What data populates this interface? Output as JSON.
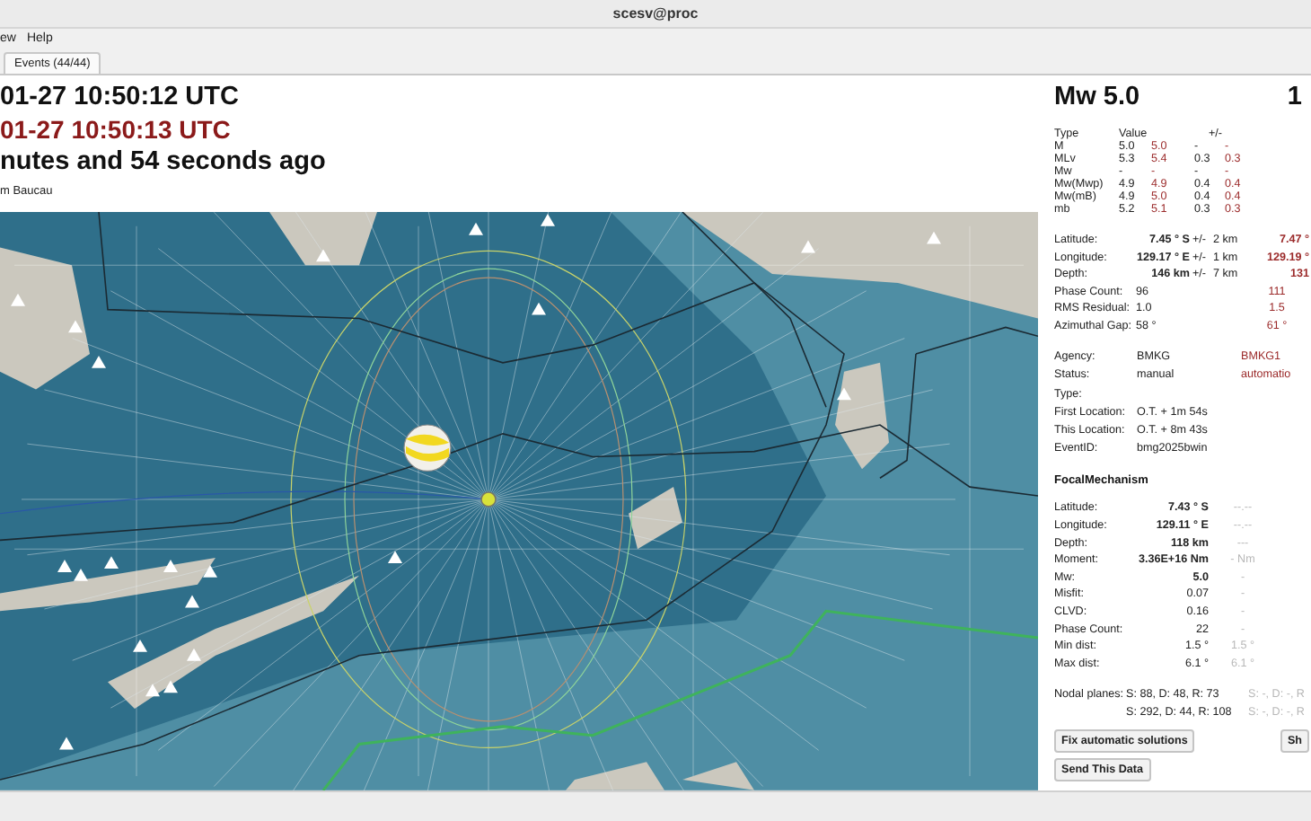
{
  "window": {
    "title": "scesv@proc"
  },
  "menu": [
    "ew",
    "Help"
  ],
  "tabs": [
    {
      "label": "Events (44/44)",
      "selected": true
    }
  ],
  "origin": {
    "time": "01-27 10:50:12 UTC",
    "time_alt": "01-27 10:50:13 UTC",
    "ago": "nutes and 54 seconds ago",
    "region": "m Baucau"
  },
  "summary": {
    "magnitude": "Mw 5.0",
    "column_2": "1"
  },
  "magnitudes": {
    "columns": [
      "Type",
      "Value",
      "+/-"
    ],
    "rows": [
      [
        "M",
        "5.0",
        "5.0",
        "-",
        "-"
      ],
      [
        "MLv",
        "5.3",
        "5.4",
        "0.3",
        "0.3"
      ],
      [
        "Mw",
        "-",
        "-",
        "-",
        "-"
      ],
      [
        "Mw(Mwp)",
        "4.9",
        "4.9",
        "0.4",
        "0.4"
      ],
      [
        "Mw(mB)",
        "4.9",
        "5.0",
        "0.4",
        "0.4"
      ],
      [
        "mb",
        "5.2",
        "5.1",
        "0.3",
        "0.3"
      ]
    ]
  },
  "location": [
    {
      "label": "Latitude:",
      "value": "7.45 ° S",
      "pm": "+/-",
      "error": "2 km",
      "alt": "7.47 °",
      "bold": true
    },
    {
      "label": "Longitude:",
      "value": "129.17 ° E",
      "pm": "+/-",
      "error": "1 km",
      "alt": "129.19 °",
      "bold": true
    },
    {
      "label": "Depth:",
      "value": "146 km",
      "pm": "+/-",
      "error": "7 km",
      "alt": "131",
      "bold": true
    },
    {
      "label": "Phase Count:",
      "value": "96",
      "alt": "111",
      "bold": false
    },
    {
      "label": "RMS Residual:",
      "value": "1.0",
      "alt": "1.5",
      "bold": false
    },
    {
      "label": "Azimuthal Gap:",
      "value": "58 °",
      "alt": "61 °",
      "bold": false
    }
  ],
  "info": [
    {
      "label": "Agency:",
      "value": "BMKG",
      "alt": "BMKG1"
    },
    {
      "label": "Status:",
      "value": "manual",
      "alt": "automatio"
    },
    {
      "label": "Type:"
    },
    {
      "label": "First Location:",
      "value": "O.T. + 1m 54s"
    },
    {
      "label": "This Location:",
      "value": "O.T. + 8m 43s"
    },
    {
      "label": "EventID:",
      "value": "bmg2025bwin"
    }
  ],
  "focal_mechanism": {
    "title": "FocalMechanism",
    "rows": [
      {
        "label": "Latitude:",
        "value": "7.43 ° S",
        "alt": "--.--",
        "bold": true
      },
      {
        "label": "Longitude:",
        "value": "129.11 ° E",
        "alt": "--.--",
        "bold": true
      },
      {
        "label": "Depth:",
        "value": "118 km",
        "alt": "---",
        "bold": true
      },
      {
        "label": "Moment:",
        "value": "3.36E+16 Nm",
        "alt": "- Nm",
        "bold": true
      },
      {
        "label": "Mw:",
        "value": "5.0",
        "alt": "-",
        "bold": true
      },
      {
        "label": "Misfit:",
        "value": "0.07",
        "alt": "-",
        "bold": false
      },
      {
        "label": "CLVD:",
        "value": "0.16",
        "alt": "-",
        "bold": false
      },
      {
        "label": "Phase Count:",
        "value": "22",
        "alt": "-",
        "bold": false
      },
      {
        "label": "Min dist:",
        "value": "1.5 °",
        "alt": "1.5 °",
        "bold": false
      },
      {
        "label": "Max dist:",
        "value": "6.1 °",
        "alt": "6.1 °",
        "bold": false
      }
    ],
    "nodal_label": "Nodal planes:",
    "nodal_planes": [
      {
        "value": "S: 88, D: 48, R: 73",
        "alt": "S: -, D: -, R"
      },
      {
        "value": "S: 292, D: 44, R: 108",
        "alt": "S: -, D: -, R"
      }
    ]
  },
  "buttons": [
    "Fix automatic solutions",
    "Send This Data"
  ],
  "button_cut": "Sh"
}
